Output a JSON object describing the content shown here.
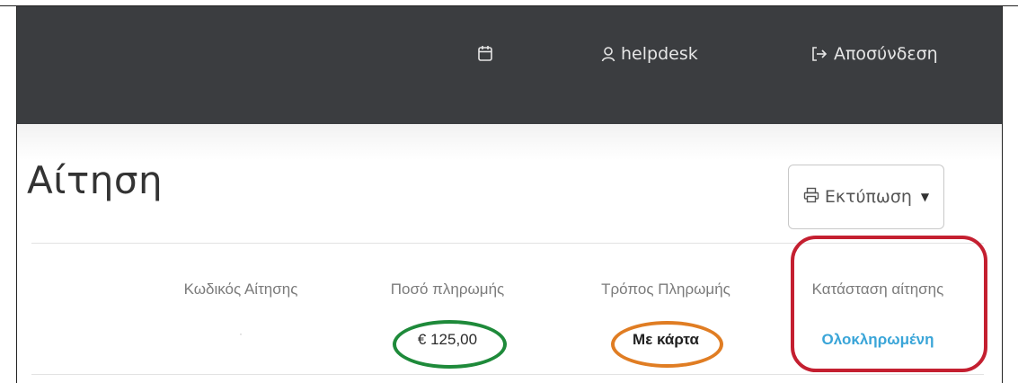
{
  "navbar": {
    "calendar_icon": "calendar-icon",
    "user_icon": "user-icon",
    "user_label": "helpdesk",
    "logout_icon": "logout-icon",
    "logout_label": "Αποσύνδεση"
  },
  "page": {
    "title": "Αίτηση"
  },
  "toolbar": {
    "print_icon": "printer-icon",
    "print_label": "Εκτύπωση",
    "print_caret": "▼"
  },
  "details": {
    "headers": {
      "code": "Κωδικός Αίτησης",
      "amount": "Ποσό πληρωμής",
      "method": "Τρόπος Πληρωμής",
      "status": "Κατάσταση αίτησης"
    },
    "values": {
      "code": "·",
      "amount": "€ 125,00",
      "method": "Με κάρτα",
      "status": "Ολοκληρωμένη"
    }
  },
  "colors": {
    "navbar_bg": "#3b3d40",
    "status_text": "#3aa5d8",
    "highlight_green": "#1e8a3a",
    "highlight_orange": "#e07d23",
    "highlight_red": "#c41f30"
  }
}
